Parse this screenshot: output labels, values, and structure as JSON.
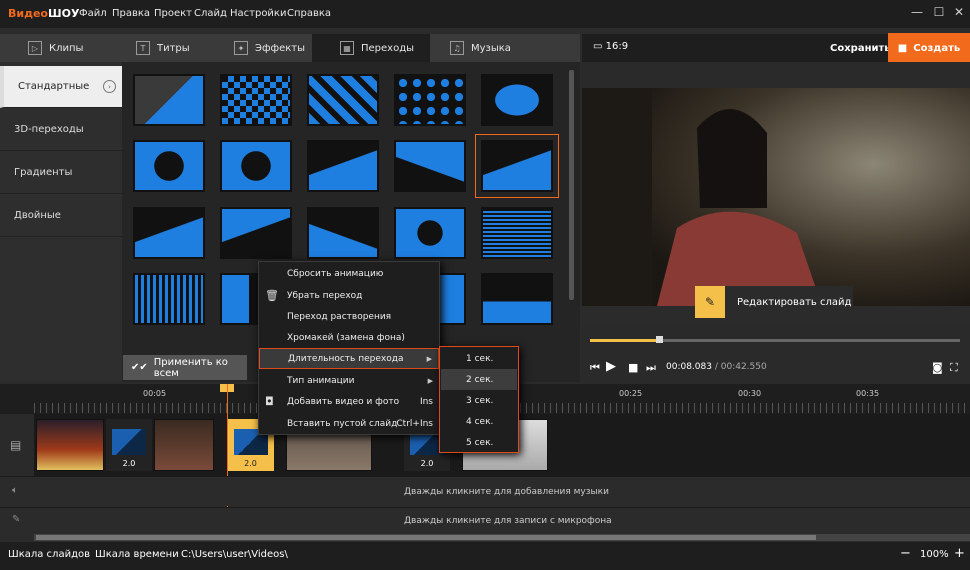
{
  "app": {
    "logo_part1": "Видео",
    "logo_part2": "ШОУ"
  },
  "menu": [
    "Файл",
    "Правка",
    "Проект",
    "Слайд",
    "Настройки",
    "Справка"
  ],
  "tabs": [
    {
      "label": "Клипы",
      "icon": "clips-icon"
    },
    {
      "label": "Титры",
      "icon": "titles-icon"
    },
    {
      "label": "Эффекты",
      "icon": "effects-icon"
    },
    {
      "label": "Переходы",
      "icon": "transitions-icon",
      "active": true
    },
    {
      "label": "Музыка",
      "icon": "music-icon"
    }
  ],
  "categories": [
    "Стандартные",
    "3D-переходы",
    "Градиенты",
    "Двойные"
  ],
  "apply_all": "Применить ко всем",
  "preview": {
    "aspect": "16:9",
    "save": "Сохранить",
    "create": "Создать",
    "edit_slide": "Редактировать слайд"
  },
  "player": {
    "current": "00:08.083",
    "separator": " / ",
    "total": "00:42.550",
    "progress": 0.19
  },
  "timeline": {
    "labels": [
      "00:05",
      "00:25",
      "00:30",
      "00:35"
    ],
    "transitions": [
      "2.0",
      "2.0",
      "2.0"
    ],
    "music_hint": "Дважды кликните для добавления музыки",
    "mic_hint": "Дважды кликните для записи с микрофона"
  },
  "context_menu": [
    {
      "label": "Сбросить анимацию"
    },
    {
      "label": "Убрать переход",
      "icon": "trash-icon"
    },
    {
      "label": "Переход растворения"
    },
    {
      "label": "Хромакей (замена фона)"
    },
    {
      "label": "Длительность перехода",
      "submenu": true,
      "highlighted": true
    },
    {
      "label": "Тип анимации",
      "submenu": true
    },
    {
      "label": "Добавить видео и фото",
      "shortcut": "Ins",
      "icon": "camera-icon"
    },
    {
      "label": "Вставить пустой слайд",
      "shortcut": "Ctrl+Ins"
    }
  ],
  "submenu": [
    "1 сек.",
    "2 сек.",
    "3 сек.",
    "4 сек.",
    "5 сек."
  ],
  "status": {
    "slides_scale": "Шкала слайдов",
    "time_scale": "Шкала времени",
    "path": "C:\\Users\\user\\Videos\\",
    "zoom": "100%"
  },
  "colors": {
    "accent": "#f26b1d",
    "highlight": "#f5c04a",
    "thumb_blue": "#1f7fe0"
  }
}
